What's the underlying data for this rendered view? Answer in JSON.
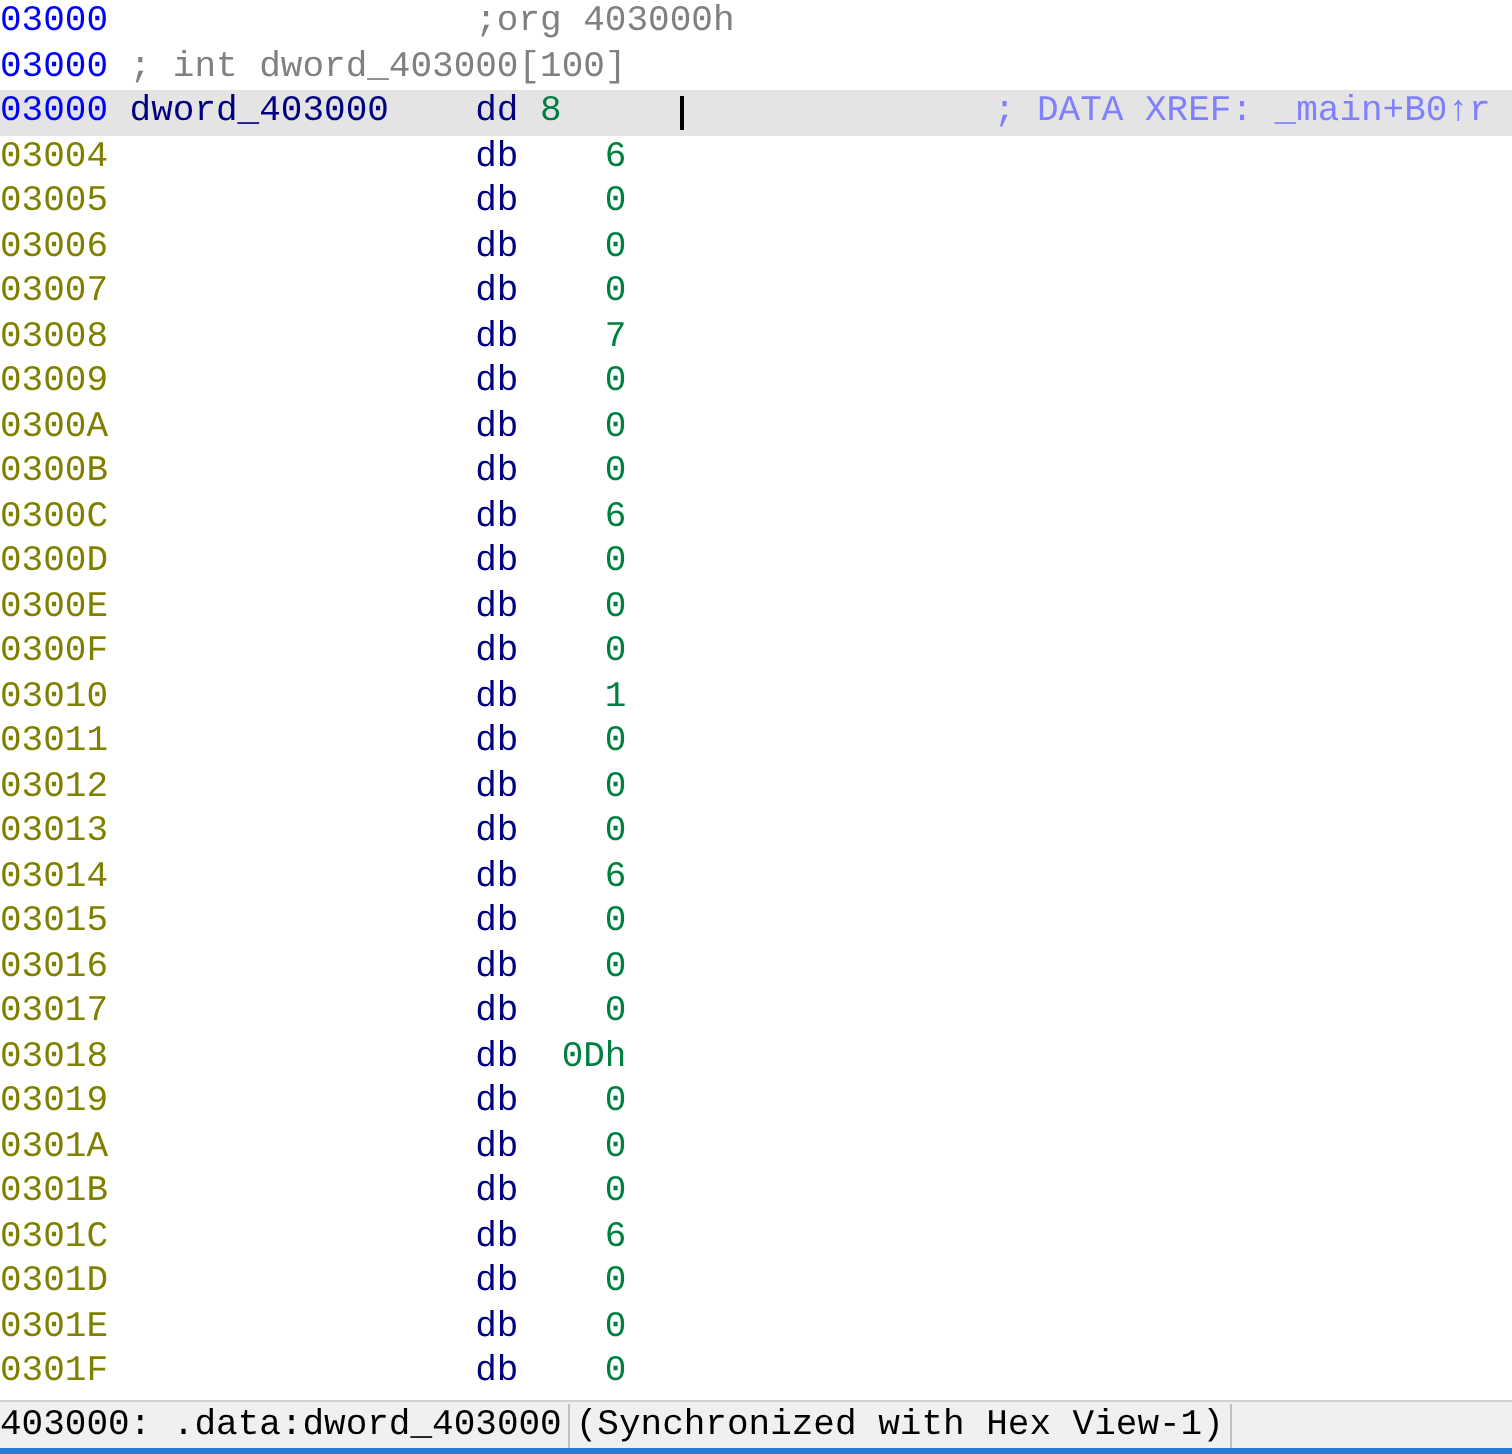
{
  "listing": {
    "lines": [
      {
        "kind": "org",
        "address": "03000",
        "text": ";org 403000h"
      },
      {
        "kind": "comment",
        "address": "03000",
        "text": "; int dword_403000[100]"
      },
      {
        "kind": "label",
        "address": "03000",
        "name": "dword_403000",
        "directive": "dd",
        "value": "8",
        "comment": "; DATA XREF: _main+B0↑r",
        "selected": true
      },
      {
        "kind": "byte",
        "address": "03004",
        "directive": "db",
        "value": "6",
        "selected": false
      },
      {
        "kind": "byte",
        "address": "03005",
        "directive": "db",
        "value": "0",
        "selected": false
      },
      {
        "kind": "byte",
        "address": "03006",
        "directive": "db",
        "value": "0",
        "selected": false
      },
      {
        "kind": "byte",
        "address": "03007",
        "directive": "db",
        "value": "0",
        "selected": false
      },
      {
        "kind": "byte",
        "address": "03008",
        "directive": "db",
        "value": "7",
        "selected": false
      },
      {
        "kind": "byte",
        "address": "03009",
        "directive": "db",
        "value": "0",
        "selected": false
      },
      {
        "kind": "byte",
        "address": "0300A",
        "directive": "db",
        "value": "0",
        "selected": false
      },
      {
        "kind": "byte",
        "address": "0300B",
        "directive": "db",
        "value": "0",
        "selected": false
      },
      {
        "kind": "byte",
        "address": "0300C",
        "directive": "db",
        "value": "6",
        "selected": false
      },
      {
        "kind": "byte",
        "address": "0300D",
        "directive": "db",
        "value": "0",
        "selected": false
      },
      {
        "kind": "byte",
        "address": "0300E",
        "directive": "db",
        "value": "0",
        "selected": false
      },
      {
        "kind": "byte",
        "address": "0300F",
        "directive": "db",
        "value": "0",
        "selected": false
      },
      {
        "kind": "byte",
        "address": "03010",
        "directive": "db",
        "value": "1",
        "selected": false
      },
      {
        "kind": "byte",
        "address": "03011",
        "directive": "db",
        "value": "0",
        "selected": false
      },
      {
        "kind": "byte",
        "address": "03012",
        "directive": "db",
        "value": "0",
        "selected": false
      },
      {
        "kind": "byte",
        "address": "03013",
        "directive": "db",
        "value": "0",
        "selected": false
      },
      {
        "kind": "byte",
        "address": "03014",
        "directive": "db",
        "value": "6",
        "selected": false
      },
      {
        "kind": "byte",
        "address": "03015",
        "directive": "db",
        "value": "0",
        "selected": false
      },
      {
        "kind": "byte",
        "address": "03016",
        "directive": "db",
        "value": "0",
        "selected": false
      },
      {
        "kind": "byte",
        "address": "03017",
        "directive": "db",
        "value": "0",
        "selected": false
      },
      {
        "kind": "byte",
        "address": "03018",
        "directive": "db",
        "value": "0Dh",
        "selected": false
      },
      {
        "kind": "byte",
        "address": "03019",
        "directive": "db",
        "value": "0",
        "selected": false
      },
      {
        "kind": "byte",
        "address": "0301A",
        "directive": "db",
        "value": "0",
        "selected": false
      },
      {
        "kind": "byte",
        "address": "0301B",
        "directive": "db",
        "value": "0",
        "selected": false
      },
      {
        "kind": "byte",
        "address": "0301C",
        "directive": "db",
        "value": "6",
        "selected": false
      },
      {
        "kind": "byte",
        "address": "0301D",
        "directive": "db",
        "value": "0",
        "selected": false
      },
      {
        "kind": "byte",
        "address": "0301E",
        "directive": "db",
        "value": "0",
        "selected": false
      },
      {
        "kind": "byte",
        "address": "0301F",
        "directive": "db",
        "value": "0",
        "selected": false
      }
    ]
  },
  "status_bar": {
    "location": "403000: .data:dword_403000",
    "sync": "(Synchronized with Hex View-1)"
  }
}
